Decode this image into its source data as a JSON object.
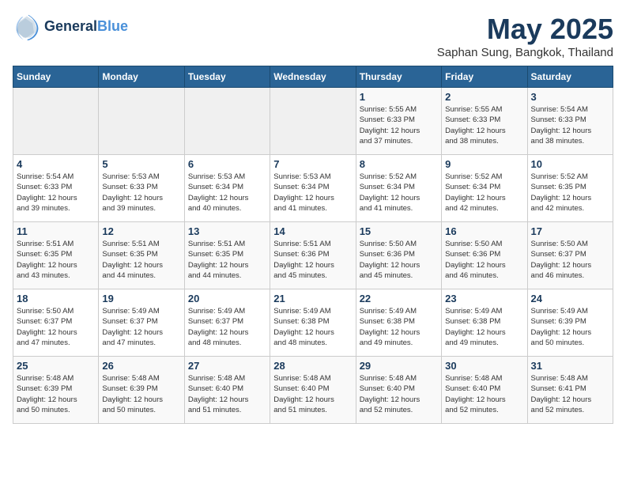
{
  "header": {
    "logo_line1": "General",
    "logo_line2": "Blue",
    "title": "May 2025",
    "location": "Saphan Sung, Bangkok, Thailand"
  },
  "weekdays": [
    "Sunday",
    "Monday",
    "Tuesday",
    "Wednesday",
    "Thursday",
    "Friday",
    "Saturday"
  ],
  "weeks": [
    [
      {
        "day": "",
        "info": ""
      },
      {
        "day": "",
        "info": ""
      },
      {
        "day": "",
        "info": ""
      },
      {
        "day": "",
        "info": ""
      },
      {
        "day": "1",
        "info": "Sunrise: 5:55 AM\nSunset: 6:33 PM\nDaylight: 12 hours\nand 37 minutes."
      },
      {
        "day": "2",
        "info": "Sunrise: 5:55 AM\nSunset: 6:33 PM\nDaylight: 12 hours\nand 38 minutes."
      },
      {
        "day": "3",
        "info": "Sunrise: 5:54 AM\nSunset: 6:33 PM\nDaylight: 12 hours\nand 38 minutes."
      }
    ],
    [
      {
        "day": "4",
        "info": "Sunrise: 5:54 AM\nSunset: 6:33 PM\nDaylight: 12 hours\nand 39 minutes."
      },
      {
        "day": "5",
        "info": "Sunrise: 5:53 AM\nSunset: 6:33 PM\nDaylight: 12 hours\nand 39 minutes."
      },
      {
        "day": "6",
        "info": "Sunrise: 5:53 AM\nSunset: 6:34 PM\nDaylight: 12 hours\nand 40 minutes."
      },
      {
        "day": "7",
        "info": "Sunrise: 5:53 AM\nSunset: 6:34 PM\nDaylight: 12 hours\nand 41 minutes."
      },
      {
        "day": "8",
        "info": "Sunrise: 5:52 AM\nSunset: 6:34 PM\nDaylight: 12 hours\nand 41 minutes."
      },
      {
        "day": "9",
        "info": "Sunrise: 5:52 AM\nSunset: 6:34 PM\nDaylight: 12 hours\nand 42 minutes."
      },
      {
        "day": "10",
        "info": "Sunrise: 5:52 AM\nSunset: 6:35 PM\nDaylight: 12 hours\nand 42 minutes."
      }
    ],
    [
      {
        "day": "11",
        "info": "Sunrise: 5:51 AM\nSunset: 6:35 PM\nDaylight: 12 hours\nand 43 minutes."
      },
      {
        "day": "12",
        "info": "Sunrise: 5:51 AM\nSunset: 6:35 PM\nDaylight: 12 hours\nand 44 minutes."
      },
      {
        "day": "13",
        "info": "Sunrise: 5:51 AM\nSunset: 6:35 PM\nDaylight: 12 hours\nand 44 minutes."
      },
      {
        "day": "14",
        "info": "Sunrise: 5:51 AM\nSunset: 6:36 PM\nDaylight: 12 hours\nand 45 minutes."
      },
      {
        "day": "15",
        "info": "Sunrise: 5:50 AM\nSunset: 6:36 PM\nDaylight: 12 hours\nand 45 minutes."
      },
      {
        "day": "16",
        "info": "Sunrise: 5:50 AM\nSunset: 6:36 PM\nDaylight: 12 hours\nand 46 minutes."
      },
      {
        "day": "17",
        "info": "Sunrise: 5:50 AM\nSunset: 6:37 PM\nDaylight: 12 hours\nand 46 minutes."
      }
    ],
    [
      {
        "day": "18",
        "info": "Sunrise: 5:50 AM\nSunset: 6:37 PM\nDaylight: 12 hours\nand 47 minutes."
      },
      {
        "day": "19",
        "info": "Sunrise: 5:49 AM\nSunset: 6:37 PM\nDaylight: 12 hours\nand 47 minutes."
      },
      {
        "day": "20",
        "info": "Sunrise: 5:49 AM\nSunset: 6:37 PM\nDaylight: 12 hours\nand 48 minutes."
      },
      {
        "day": "21",
        "info": "Sunrise: 5:49 AM\nSunset: 6:38 PM\nDaylight: 12 hours\nand 48 minutes."
      },
      {
        "day": "22",
        "info": "Sunrise: 5:49 AM\nSunset: 6:38 PM\nDaylight: 12 hours\nand 49 minutes."
      },
      {
        "day": "23",
        "info": "Sunrise: 5:49 AM\nSunset: 6:38 PM\nDaylight: 12 hours\nand 49 minutes."
      },
      {
        "day": "24",
        "info": "Sunrise: 5:49 AM\nSunset: 6:39 PM\nDaylight: 12 hours\nand 50 minutes."
      }
    ],
    [
      {
        "day": "25",
        "info": "Sunrise: 5:48 AM\nSunset: 6:39 PM\nDaylight: 12 hours\nand 50 minutes."
      },
      {
        "day": "26",
        "info": "Sunrise: 5:48 AM\nSunset: 6:39 PM\nDaylight: 12 hours\nand 50 minutes."
      },
      {
        "day": "27",
        "info": "Sunrise: 5:48 AM\nSunset: 6:40 PM\nDaylight: 12 hours\nand 51 minutes."
      },
      {
        "day": "28",
        "info": "Sunrise: 5:48 AM\nSunset: 6:40 PM\nDaylight: 12 hours\nand 51 minutes."
      },
      {
        "day": "29",
        "info": "Sunrise: 5:48 AM\nSunset: 6:40 PM\nDaylight: 12 hours\nand 52 minutes."
      },
      {
        "day": "30",
        "info": "Sunrise: 5:48 AM\nSunset: 6:40 PM\nDaylight: 12 hours\nand 52 minutes."
      },
      {
        "day": "31",
        "info": "Sunrise: 5:48 AM\nSunset: 6:41 PM\nDaylight: 12 hours\nand 52 minutes."
      }
    ]
  ]
}
